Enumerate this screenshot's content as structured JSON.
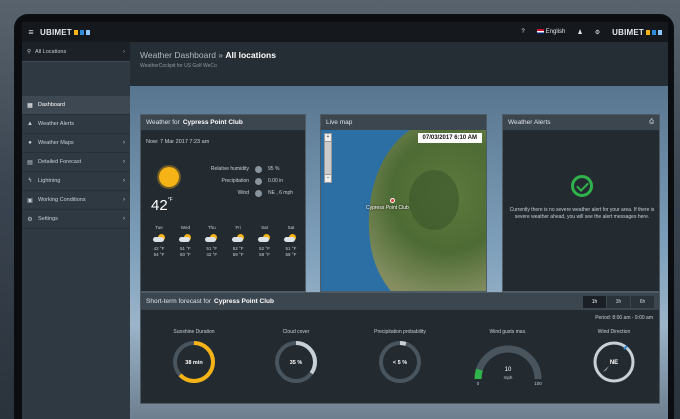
{
  "topbar": {
    "brand": "UBIMET",
    "help": "?",
    "language": "English",
    "user_icon": "♟",
    "settings_icon": "⚙",
    "brand_right": "UBIMET"
  },
  "sidebar": {
    "location": "All Locations",
    "items": [
      {
        "label": "Dashboard",
        "icon": "▦"
      },
      {
        "label": "Weather Alerts",
        "icon": "▲"
      },
      {
        "label": "Weather Maps",
        "icon": "●"
      },
      {
        "label": "Detailed Forecast",
        "icon": "▤"
      },
      {
        "label": "Lightning",
        "icon": "ϟ"
      },
      {
        "label": "Working Conditions",
        "icon": "▣"
      },
      {
        "label": "Settings",
        "icon": "⚙"
      }
    ]
  },
  "header": {
    "title_prefix": "Weather Dashboard »",
    "title_bold": "All locations",
    "subtitle": "WeatherCockpit for US Golf WeCo"
  },
  "weather_panel": {
    "title_prefix": "Weather for",
    "title_bold": "Cypress Point Club",
    "datetime": "Now: 7 Mar 2017 7:23 am",
    "temp": "42",
    "temp_unit": "°F",
    "stats": [
      {
        "label": "Relative humidity",
        "value": "95 %"
      },
      {
        "label": "Precipitation",
        "value": "0.00 in"
      },
      {
        "label": "Wind",
        "value": "NE , 6 mph"
      }
    ],
    "days": [
      {
        "name": "Tue",
        "high": "42 °F",
        "low": "54 °F"
      },
      {
        "name": "Wed",
        "high": "51 °F",
        "low": "60 °F"
      },
      {
        "name": "Thu",
        "high": "51 °F",
        "low": "42 °F"
      },
      {
        "name": "Fri",
        "high": "52 °F",
        "low": "59 °F"
      },
      {
        "name": "Sat",
        "high": "52 °F",
        "low": "58 °F"
      },
      {
        "name": "Sat",
        "high": "51 °F",
        "low": "59 °F"
      }
    ]
  },
  "map_panel": {
    "title": "Live map",
    "date": "07/03/2017 6:10 AM",
    "label": "Cypress Point Club",
    "zoom_in": "+",
    "zoom_out": "–"
  },
  "alerts_panel": {
    "title": "Weather Alerts",
    "message": "Currently there is no severe weather alert for your area. If there is severe weather ahead, you will see the alert messages here."
  },
  "forecast_panel": {
    "title_prefix": "Short-term forecast for",
    "title_bold": "Cypress Point Club",
    "tabs": [
      "1h",
      "3h",
      "6h"
    ],
    "active_tab": "1h",
    "period": "Period: 8:00 am - 9:00 am",
    "gauges": [
      {
        "label": "Sunshine Duration",
        "value": "38 min",
        "fraction": 0.63,
        "color": "#f5b316"
      },
      {
        "label": "Cloud cover",
        "value": "35 %",
        "fraction": 0.35,
        "color": "#c9d1d8"
      },
      {
        "label": "Precipitation probability",
        "value": "< 5 %",
        "fraction": 0.05,
        "color": "#c9d1d8"
      },
      {
        "label": "Wind gusts max.",
        "value": "10",
        "unit": "mph",
        "min": "0",
        "max": "100",
        "fraction": 0.1,
        "color": "#2fb34a"
      },
      {
        "label": "Wind Direction",
        "value": "NE"
      }
    ]
  },
  "colors": {
    "accent": "#f5b316",
    "ok": "#2fb34a",
    "panel": "#232b31"
  }
}
